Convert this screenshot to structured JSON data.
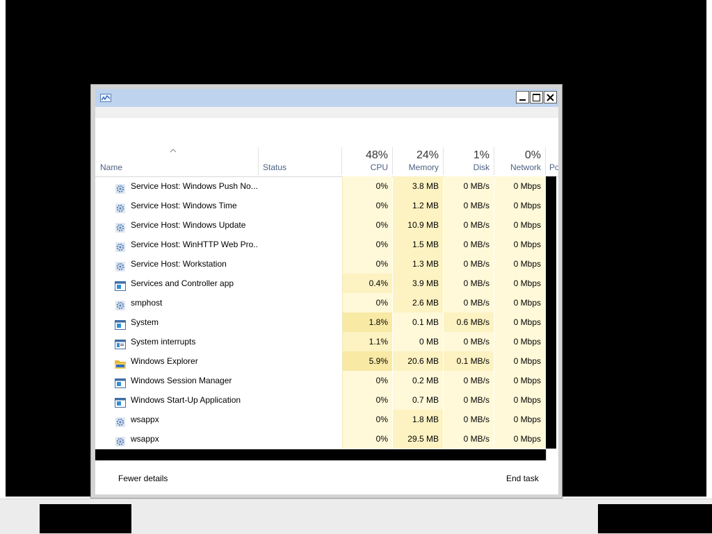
{
  "header": {
    "name_label": "Name",
    "status_label": "Status",
    "cpu_pct": "48%",
    "cpu_label": "CPU",
    "memory_pct": "24%",
    "memory_label": "Memory",
    "disk_pct": "1%",
    "disk_label": "Disk",
    "network_pct": "0%",
    "network_label": "Network",
    "power_label": "Po"
  },
  "rows": [
    {
      "icon": "gear-icon",
      "name": "Service Host: Windows Push No...",
      "status": "",
      "cpu": "0%",
      "memory": "3.8 MB",
      "disk": "0 MB/s",
      "network": "0 Mbps"
    },
    {
      "icon": "gear-icon",
      "name": "Service Host: Windows Time",
      "status": "",
      "cpu": "0%",
      "memory": "1.2 MB",
      "disk": "0 MB/s",
      "network": "0 Mbps"
    },
    {
      "icon": "gear-icon",
      "name": "Service Host: Windows Update",
      "status": "",
      "cpu": "0%",
      "memory": "10.9 MB",
      "disk": "0 MB/s",
      "network": "0 Mbps"
    },
    {
      "icon": "gear-icon",
      "name": "Service Host: WinHTTP Web Pro...",
      "status": "",
      "cpu": "0%",
      "memory": "1.5 MB",
      "disk": "0 MB/s",
      "network": "0 Mbps"
    },
    {
      "icon": "gear-icon",
      "name": "Service Host: Workstation",
      "status": "",
      "cpu": "0%",
      "memory": "1.3 MB",
      "disk": "0 MB/s",
      "network": "0 Mbps"
    },
    {
      "icon": "app-window-icon",
      "name": "Services and Controller app",
      "status": "",
      "cpu": "0.4%",
      "memory": "3.9 MB",
      "disk": "0 MB/s",
      "network": "0 Mbps"
    },
    {
      "icon": "gear-icon",
      "name": "smphost",
      "status": "",
      "cpu": "0%",
      "memory": "2.6 MB",
      "disk": "0 MB/s",
      "network": "0 Mbps"
    },
    {
      "icon": "app-window-icon",
      "name": "System",
      "status": "",
      "cpu": "1.8%",
      "memory": "0.1 MB",
      "disk": "0.6 MB/s",
      "network": "0 Mbps"
    },
    {
      "icon": "interrupts-icon",
      "name": "System interrupts",
      "status": "",
      "cpu": "1.1%",
      "memory": "0 MB",
      "disk": "0 MB/s",
      "network": "0 Mbps"
    },
    {
      "icon": "folder-icon",
      "name": "Windows Explorer",
      "status": "",
      "cpu": "5.9%",
      "memory": "20.6 MB",
      "disk": "0.1 MB/s",
      "network": "0 Mbps"
    },
    {
      "icon": "app-window-icon",
      "name": "Windows Session Manager",
      "status": "",
      "cpu": "0%",
      "memory": "0.2 MB",
      "disk": "0 MB/s",
      "network": "0 Mbps"
    },
    {
      "icon": "app-window-icon",
      "name": "Windows Start-Up Application",
      "status": "",
      "cpu": "0%",
      "memory": "0.7 MB",
      "disk": "0 MB/s",
      "network": "0 Mbps"
    },
    {
      "icon": "gear-icon",
      "name": "wsappx",
      "status": "",
      "cpu": "0%",
      "memory": "1.8 MB",
      "disk": "0 MB/s",
      "network": "0 Mbps"
    },
    {
      "icon": "gear-icon",
      "name": "wsappx",
      "status": "",
      "cpu": "0%",
      "memory": "29.5 MB",
      "disk": "0 MB/s",
      "network": "0 Mbps"
    }
  ],
  "footer": {
    "fewer_details": "Fewer details",
    "end_task": "End task"
  },
  "colors": {
    "heat_light": "#fff9d9",
    "heat_mid": "#fcf2c2",
    "heat_strong": "#f8e9a4",
    "titlebar": "#bed3ee"
  }
}
